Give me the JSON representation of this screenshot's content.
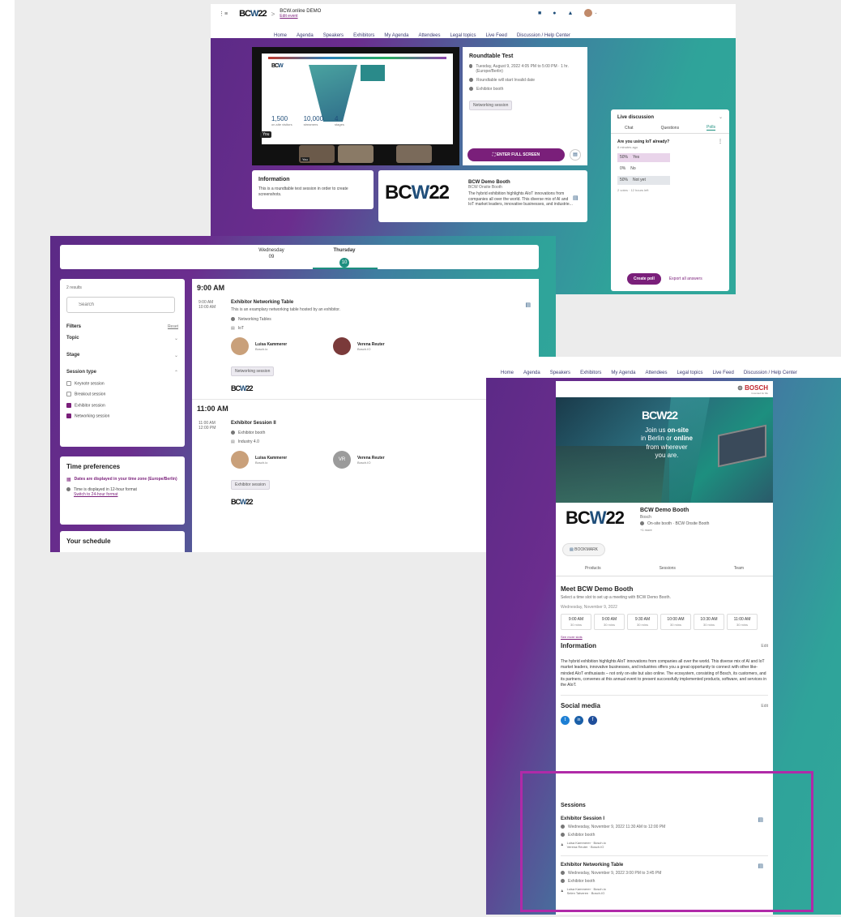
{
  "colors": {
    "accent": "#7a1f7a",
    "teal": "#1d8f7f",
    "navy": "#1f4e7a",
    "highlight_box": "#b02aa8"
  },
  "shot1": {
    "logo": "BCW22",
    "breadcrumb_sep": ">",
    "event_title": "BCW.online DEMO",
    "edit_event": "Edit event",
    "nav": [
      "Home",
      "Agenda",
      "Speakers",
      "Exhibitors",
      "My Agenda",
      "Attendees",
      "Legal topics",
      "Live Feed",
      "Discussion / Help Center"
    ],
    "session": {
      "title": "Roundtable Test",
      "date": "Tuesday, August 9, 2022 4:05 PM to 5:00 PM · 1 hr. (Europe/Berlin)",
      "notice": "Roundtable will start Invalid date",
      "location": "Exhibitor booth",
      "tag": "Networking session"
    },
    "video": {
      "you_label": "You",
      "stats": [
        {
          "value": "1,500",
          "label": "on-site visitors"
        },
        {
          "value": "10,000",
          "label": "streamers"
        },
        {
          "value": "4",
          "label": "stages"
        }
      ]
    },
    "fullscreen": "ENTER FULL SCREEN",
    "info_title": "Information",
    "info_text": "This is a roundtable test session in order to create screenshots.",
    "booth": {
      "name": "BCW Demo Booth",
      "sub": "BCW Onsite Booth",
      "desc": "The hybrid exhibition highlights AIoT innovations from companies all over the world. This diverse mix of AI and IoT market leaders, innovative businesses, and industrie..."
    },
    "live": {
      "title": "Live discussion",
      "tabs": [
        "Chat",
        "Questions",
        "Polls"
      ],
      "question": "Are you using IoT already?",
      "ago": "8 minutes ago",
      "options": [
        {
          "pct": "50%",
          "label": "Yes",
          "fill": 0.5
        },
        {
          "pct": "0%",
          "label": "No",
          "fill": 0
        },
        {
          "pct": "50%",
          "label": "Not yet",
          "fill": 0.5
        }
      ],
      "votes": "2 votes · 12 hours left",
      "create_poll": "Create poll",
      "export": "Export all answers"
    }
  },
  "shot2": {
    "days": [
      {
        "name": "Wednesday",
        "num": "09"
      },
      {
        "name": "Thursday",
        "num": "10"
      }
    ],
    "results": "2 results",
    "search_placeholder": "Search",
    "filters": "Filters",
    "reset": "Reset",
    "filter_groups": [
      "Topic",
      "Stage",
      "Session type"
    ],
    "session_types": [
      {
        "label": "Keynote session",
        "on": false
      },
      {
        "label": "Breakout session",
        "on": false
      },
      {
        "label": "Exhibitor session",
        "on": true
      },
      {
        "label": "Networking session",
        "on": true
      }
    ],
    "time_pref_title": "Time preferences",
    "tz_notice": "Dates are displayed in your time zone (Europe/Berlin)",
    "format_notice": "Time is displayed in 12-hour format",
    "switch_format": "Switch to 24-hour format",
    "your_schedule": "Your schedule",
    "slots": [
      {
        "time": "9:00 AM",
        "start": "9:00 AM",
        "end": "10:00 AM",
        "title": "Exhibitor Networking Table",
        "desc": "This is an examplary networking table hosted by an exhibitor.",
        "location": "Networking Tables",
        "track": "IoT",
        "speakers": [
          {
            "name": "Luisa Kammerer",
            "org": "Bosch.io"
          },
          {
            "name": "Verena Reuter",
            "org": "Bosch.IO"
          }
        ],
        "tag": "Networking session",
        "logo": "BCW22"
      },
      {
        "time": "11:00 AM",
        "start": "11:00 AM",
        "end": "12:00 PM",
        "title": "Exhibitor Session II",
        "desc": "",
        "location": "Exhibitor booth",
        "track": "Industry 4.0",
        "speakers": [
          {
            "name": "Luisa Kammerer",
            "org": "Bosch.io"
          },
          {
            "name": "Verena Reuter",
            "org": "Bosch.IO",
            "initials": "VR"
          }
        ],
        "tag": "Exhibitor session",
        "logo": "BCW22"
      }
    ]
  },
  "shot3": {
    "nav": [
      "Home",
      "Agenda",
      "Speakers",
      "Exhibitors",
      "My Agenda",
      "Attendees",
      "Legal topics",
      "Live Feed",
      "Discussion / Help Center"
    ],
    "bosch": "BOSCH",
    "bosch_tag": "Invented for life",
    "banner": {
      "logo": "BCW22",
      "line1": "Join us ",
      "line1b": "on-site",
      "line2": "in Berlin or ",
      "line2b": "online",
      "line3": "from wherever",
      "line4": "you are."
    },
    "booth_name": "BCW Demo Booth",
    "booth_company": "Bosch",
    "booth_loc": "On-site booth · BCW Onsite Booth",
    "booth_more": "+1 more",
    "bookmark": "BOOKMARK",
    "tabs": [
      "Products",
      "Sessions",
      "Team"
    ],
    "meet_title": "Meet BCW Demo Booth",
    "meet_sub": "Select a time slot to set up a meeting with BCW Demo Booth.",
    "meet_date": "Wednesday, November 9, 2022",
    "slots": [
      {
        "t": "9:00 AM",
        "d": "30 mins"
      },
      {
        "t": "9:00 AM",
        "d": "30 mins"
      },
      {
        "t": "9:30 AM",
        "d": "30 mins"
      },
      {
        "t": "10:00 AM",
        "d": "30 mins"
      },
      {
        "t": "10:30 AM",
        "d": "30 mins"
      },
      {
        "t": "11:00 AM",
        "d": "30 mins"
      }
    ],
    "see_more": "See more slots",
    "info_title": "Information",
    "edit": "Edit",
    "info_text": "The hybrid exhibition highlights AIoT innovations from companies all over the world. This diverse mix of AI and IoT market leaders, innovative businesses, and industries offers you a great opportunity to connect with other like-minded AIoT enthusiasts – not only on-site but also online. The ecosystem, consisting of Bosch, its customers, and its partners, convenes at this annual event to present successfully implemented products, software, and services in the AIoT.",
    "social_title": "Social media",
    "sessions_title": "Sessions",
    "sessions": [
      {
        "title": "Exhibitor Session I",
        "date": "Wednesday, November 9, 2022 11:30 AM to 12:00 PM",
        "loc": "Exhibitor booth",
        "sp1": "Luisa Kammerer · Bosch.io",
        "sp2": "Verena Reuter · Bosch.IO"
      },
      {
        "title": "Exhibitor Networking Table",
        "date": "Wednesday, November 9, 2022 3:00 PM to 3:45 PM",
        "loc": "Exhibitor booth",
        "sp1": "Luisa Kammerer · Bosch.io",
        "sp2": "Selen Tatveren · Bosch.IO"
      }
    ]
  }
}
